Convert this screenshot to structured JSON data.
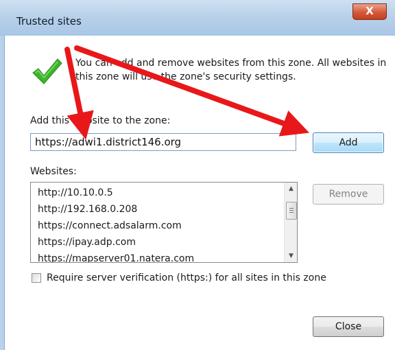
{
  "window": {
    "title": "Trusted sites",
    "close_glyph": "X"
  },
  "description": "You can add and remove websites from this zone. All websites in this zone will use the zone's security settings.",
  "add_section": {
    "label": "Add this website to the zone:",
    "input_value": "https://adwi1.district146.org",
    "add_button": "Add"
  },
  "websites": {
    "label": "Websites:",
    "items": [
      "http://10.10.0.5",
      "http://192.168.0.208",
      "https://connect.adsalarm.com",
      "https://ipay.adp.com",
      "https://mapserver01.natera.com"
    ],
    "remove_button": "Remove"
  },
  "verification": {
    "label": "Require server verification (https:) for all sites in this zone",
    "checked": false
  },
  "close_button": "Close",
  "icons": {
    "zone": "checkmark-icon",
    "annotation": "red-arrow-icon"
  },
  "colors": {
    "arrow": "#e8181a",
    "check": "#3db52a"
  }
}
